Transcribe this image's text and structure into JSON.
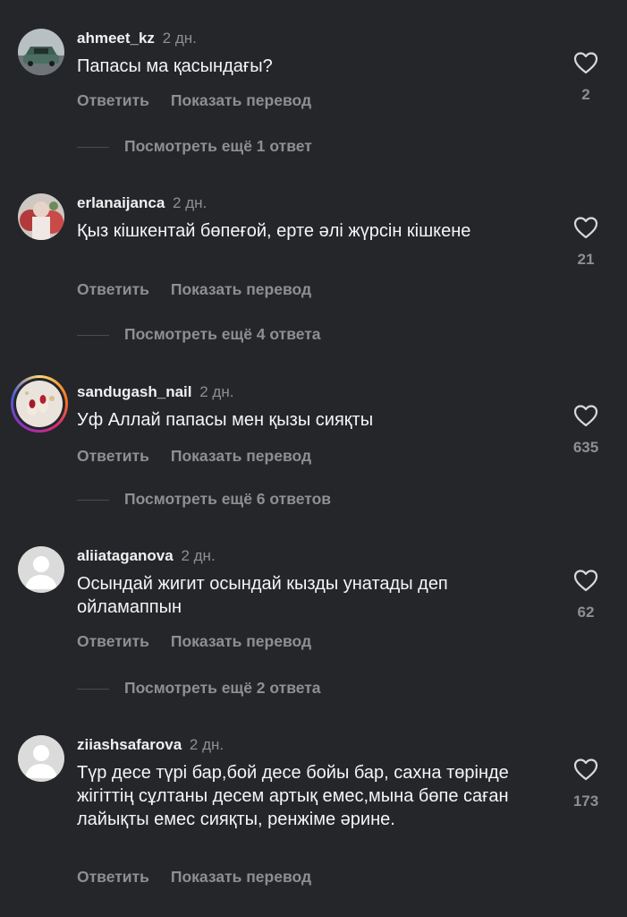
{
  "comments": [
    {
      "username": "ahmeet_kz",
      "time": "2 дн.",
      "text": "Папасы ма қасындағы?",
      "reply_label": "Ответить",
      "translate_label": "Показать перевод",
      "likes": "2",
      "more_replies": "Посмотреть ещё 1 ответ"
    },
    {
      "username": "erlanaijanca",
      "time": "2 дн.",
      "text": "Қыз кішкентай бөпеғой, ерте әлі жүрсін кішкене",
      "reply_label": "Ответить",
      "translate_label": "Показать перевод",
      "likes": "21",
      "more_replies": "Посмотреть ещё 4 ответа"
    },
    {
      "username": "sandugash_nail",
      "time": "2 дн.",
      "text": "Уф Аллай папасы мен қызы сияқты",
      "reply_label": "Ответить",
      "translate_label": "Показать перевод",
      "likes": "635",
      "more_replies": "Посмотреть ещё 6 ответов"
    },
    {
      "username": "aliiataganova",
      "time": "2 дн.",
      "text": "Осындай жигит осындай кызды унатады деп ойламаппын",
      "reply_label": "Ответить",
      "translate_label": "Показать перевод",
      "likes": "62",
      "more_replies": "Посмотреть ещё 2 ответа"
    },
    {
      "username": "ziiashsafarova",
      "time": "2 дн.",
      "text": "Түр десе түрі бар,бой десе бойы бар, сахна төрінде жігіттің сұлтаны десем артық емес,мына бөпе саған лайықты емес сияқты, ренжіме әрине.",
      "reply_label": "Ответить",
      "translate_label": "Показать перевод",
      "likes": "173"
    }
  ],
  "icons": {
    "like": "heart-outline-icon",
    "default_avatar": "person-silhouette-icon"
  },
  "colors": {
    "background": "#25262a",
    "primary_text": "#f5f5f5",
    "secondary_text": "#8e8e93",
    "story_ring": [
      "#feda75",
      "#fa7e1e",
      "#d62976",
      "#962fbf",
      "#4f5bd5"
    ]
  }
}
